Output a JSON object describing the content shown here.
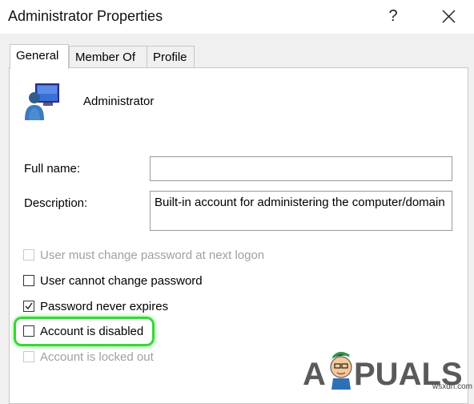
{
  "window": {
    "title": "Administrator Properties",
    "help_label": "?",
    "close_icon": "close-icon"
  },
  "tabs": [
    {
      "label": "General",
      "active": true
    },
    {
      "label": "Member Of",
      "active": false
    },
    {
      "label": "Profile",
      "active": false
    }
  ],
  "user": {
    "icon": "user-computer-icon",
    "name": "Administrator"
  },
  "fields": {
    "full_name_label": "Full name:",
    "full_name_value": "",
    "description_label": "Description:",
    "description_value": "Built-in account for administering the computer/domain"
  },
  "options": [
    {
      "label": "User must change password at next logon",
      "checked": false,
      "disabled": true
    },
    {
      "label": "User cannot change password",
      "checked": false,
      "disabled": false
    },
    {
      "label": "Password never expires",
      "checked": true,
      "disabled": false
    },
    {
      "label": "Account is disabled",
      "checked": false,
      "disabled": false
    },
    {
      "label": "Account is locked out",
      "checked": false,
      "disabled": true
    }
  ],
  "watermark": {
    "brand": "APPUALS",
    "site": "wsxdn.com"
  },
  "colors": {
    "highlight": "#39d639",
    "disabled_text": "#a0a0a0"
  }
}
